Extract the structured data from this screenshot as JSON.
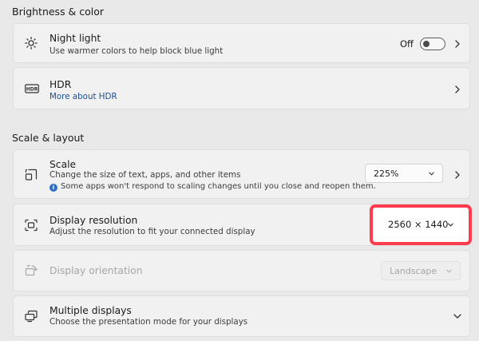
{
  "brightness_section": {
    "title": "Brightness & color"
  },
  "night_light": {
    "title": "Night light",
    "subtitle": "Use warmer colors to help block blue light",
    "toggle_label": "Off",
    "icon": "brightness-icon"
  },
  "hdr": {
    "title": "HDR",
    "link": "More about HDR",
    "icon": "hdr-icon",
    "icon_text": "HDR"
  },
  "scale_section": {
    "title": "Scale & layout"
  },
  "scale": {
    "title": "Scale",
    "subtitle": "Change the size of text, apps, and other items",
    "info_glyph": "i",
    "info": "Some apps won't respond to scaling changes until you close and reopen them.",
    "value": "225%",
    "icon": "scale-icon"
  },
  "display_resolution": {
    "title": "Display resolution",
    "subtitle": "Adjust the resolution to fit your connected display",
    "value": "2560 × 1440",
    "icon": "resolution-icon",
    "highlight_color": "#ff3b4e"
  },
  "display_orientation": {
    "title": "Display orientation",
    "value": "Landscape",
    "disabled": true,
    "icon": "orientation-icon"
  },
  "multiple_displays": {
    "title": "Multiple displays",
    "subtitle": "Choose the presentation mode for your displays",
    "icon": "multiple-displays-icon"
  }
}
